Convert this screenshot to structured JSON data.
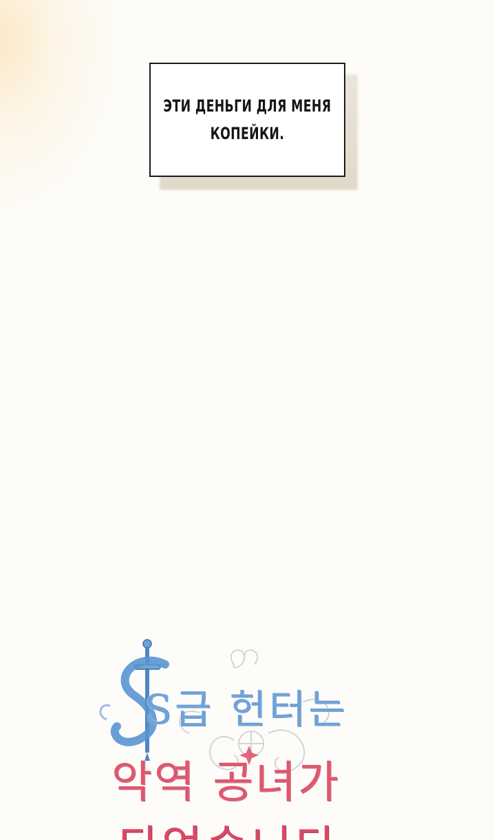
{
  "caption": {
    "line1": "ЭТИ ДЕНЬГИ ДЛЯ МЕНЯ",
    "line2": "КОПЕЙКИ."
  },
  "logo": {
    "line1": "S급 헌터는",
    "line2": "악역 공녀가",
    "line3": "되었습니다",
    "colors": {
      "blue": "#6ea3d9",
      "pink": "#e0566e",
      "ornament": "#c9cdd6"
    }
  },
  "background": {
    "base": "#fdfcf9",
    "glow": "#fbe9c9"
  }
}
